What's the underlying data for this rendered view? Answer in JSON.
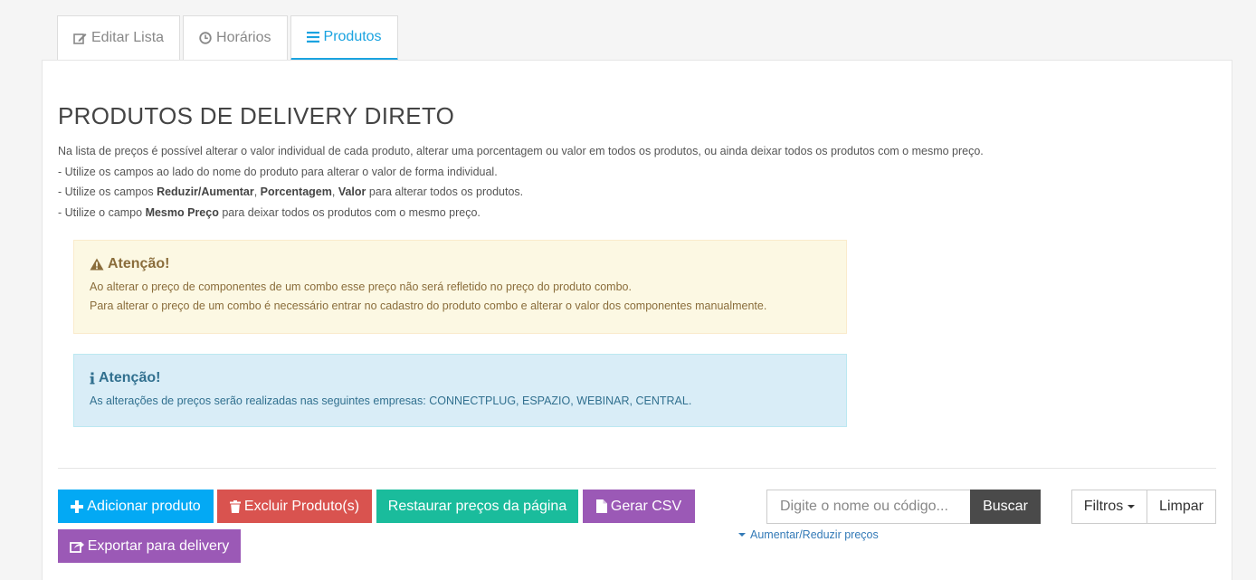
{
  "tabs": [
    {
      "label": "Editar Lista",
      "icon": "edit-icon"
    },
    {
      "label": "Horários",
      "icon": "clock-icon"
    },
    {
      "label": "Produtos",
      "icon": "list-icon",
      "active": true
    }
  ],
  "page": {
    "title": "PRODUTOS DE DELIVERY DIRETO",
    "intro": "Na lista de preços é possível alterar o valor individual de cada produto, alterar uma porcentagem ou valor em todos os produtos, ou ainda deixar todos os produtos com o mesmo preço.",
    "line1": "- Utilize os campos ao lado do nome do produto para alterar o valor de forma individual.",
    "line2_pre": "- Utilize os campos ",
    "line2_b1": "Reduzir/Aumentar",
    "line2_sep1": ", ",
    "line2_b2": "Porcentagem",
    "line2_sep2": ", ",
    "line2_b3": "Valor",
    "line2_post": " para alterar todos os produtos.",
    "line3_pre": "- Utilize o campo ",
    "line3_b": "Mesmo Preço",
    "line3_post": " para deixar todos os produtos com o mesmo preço."
  },
  "alerts": {
    "warning": {
      "title": "Atenção!",
      "line1": "Ao alterar o preço de componentes de um combo esse preço não será refletido no preço do produto combo.",
      "line2": "Para alterar o preço de um combo é necessário entrar no cadastro do produto combo e alterar o valor dos componentes manualmente."
    },
    "info": {
      "title": "Atenção!",
      "text": "As alterações de preços serão realizadas nas seguintes empresas: CONNECTPLUG, ESPAZIO, WEBINAR, CENTRAL."
    }
  },
  "actions": {
    "add": "Adicionar produto",
    "delete": "Excluir Produto(s)",
    "restore": "Restaurar preços da página",
    "csv": "Gerar CSV",
    "export": "Exportar para delivery"
  },
  "search": {
    "placeholder": "Digite o nome ou código...",
    "value": "",
    "button": "Buscar",
    "toggle": "Aumentar/Reduzir preços"
  },
  "filters": {
    "label": "Filtros",
    "clear": "Limpar"
  },
  "colors": {
    "primary": "#03a9f4",
    "danger": "#d9534f",
    "success": "#1abc9c",
    "purple": "#9b59b6",
    "dark": "#4a4a4a",
    "tab_active": "#1aa3e0"
  }
}
